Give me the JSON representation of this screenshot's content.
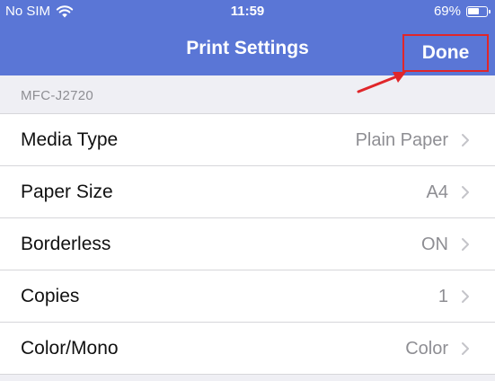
{
  "status_bar": {
    "carrier": "No SIM",
    "time": "11:59",
    "battery": "69%",
    "battery_level": 0.69
  },
  "nav": {
    "title": "Print Settings",
    "done_label": "Done"
  },
  "section": {
    "header": "MFC-J2720"
  },
  "rows": [
    {
      "label": "Media Type",
      "value": "Plain Paper"
    },
    {
      "label": "Paper Size",
      "value": "A4"
    },
    {
      "label": "Borderless",
      "value": "ON"
    },
    {
      "label": "Copies",
      "value": "1"
    },
    {
      "label": "Color/Mono",
      "value": "Color"
    }
  ],
  "colors": {
    "header_bg": "#5a76d6",
    "annotation_red": "#e0262a",
    "secondary_text": "#8e8e93"
  },
  "icons": [
    "wifi-icon",
    "battery-icon",
    "chevron-right-icon",
    "annotation-arrow-icon"
  ]
}
